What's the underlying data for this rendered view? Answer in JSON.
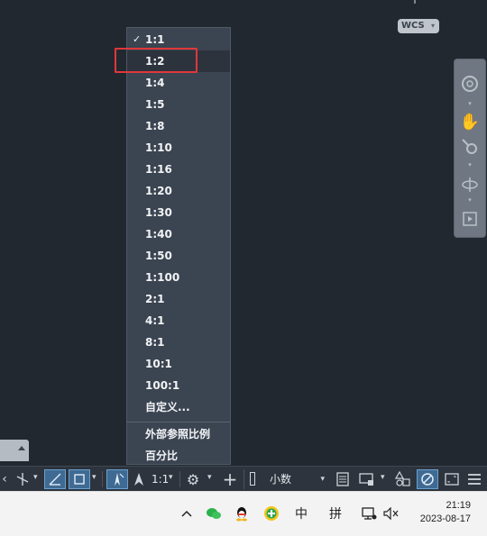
{
  "viewport": {
    "wcs_label": "WCS"
  },
  "scale_menu": {
    "checked_index": 0,
    "highlighted_index": 1,
    "items": [
      "1:1",
      "1:2",
      "1:4",
      "1:5",
      "1:8",
      "1:10",
      "1:16",
      "1:20",
      "1:30",
      "1:40",
      "1:50",
      "1:100",
      "2:1",
      "4:1",
      "8:1",
      "10:1",
      "100:1",
      "自定义..."
    ],
    "extra_items": [
      "外部参照比例",
      "百分比"
    ]
  },
  "statusbar": {
    "annotation_scale": "1:1",
    "units": "小数"
  },
  "taskbar": {
    "ime_mode": "中",
    "ime_input": "拼",
    "time": "21:19",
    "date": "2023-08-17"
  },
  "colors": {
    "canvas": "#212830",
    "menu_bg": "#3b4451",
    "highlight_border": "#e0373b",
    "active_button": "#3f6a93"
  }
}
